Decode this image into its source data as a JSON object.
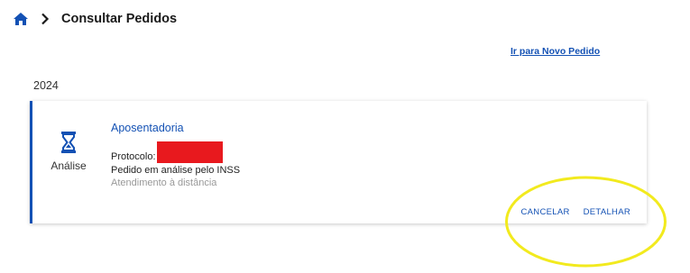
{
  "breadcrumb": {
    "home_icon": "home-icon",
    "separator_icon": "chevron-right-icon",
    "title": "Consultar Pedidos"
  },
  "new_order_link": "Ir para Novo Pedido",
  "year": "2024",
  "request": {
    "status_icon": "hourglass-icon",
    "status_label": "Análise",
    "benefit": "Aposentadoria",
    "protocol_label": "Protocolo:",
    "status_text": "Pedido em análise pelo INSS",
    "channel": "Atendimento à distância",
    "actions": {
      "cancel": "CANCELAR",
      "details": "DETALHAR"
    }
  },
  "colors": {
    "accent": "#1351b4",
    "redaction": "#e8191e",
    "highlight": "#f2ea1e"
  }
}
